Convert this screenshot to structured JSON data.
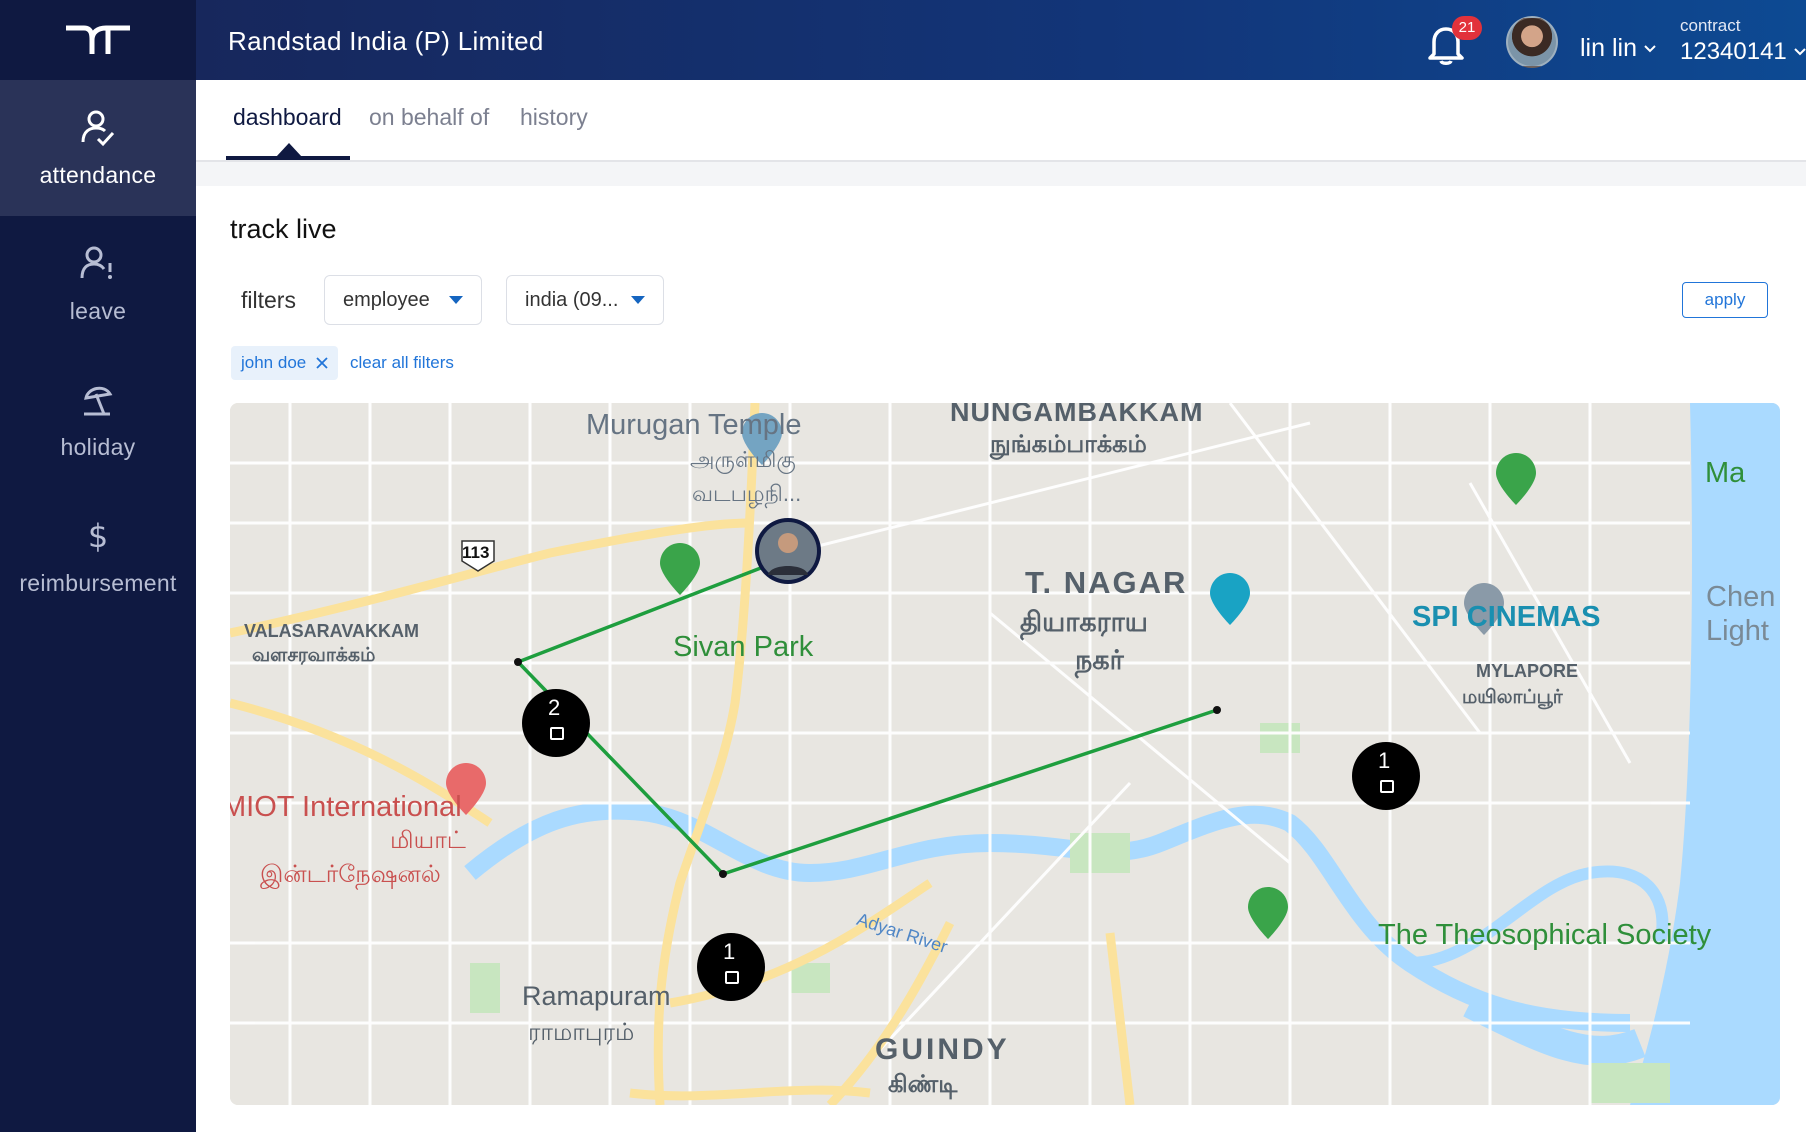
{
  "sidebar": {
    "items": [
      {
        "label": "attendance",
        "icon": "attendance-icon",
        "active": true
      },
      {
        "label": "leave",
        "icon": "leave-icon",
        "active": false
      },
      {
        "label": "holiday",
        "icon": "holiday-icon",
        "active": false
      },
      {
        "label": "reimbursement",
        "icon": "dollar-icon",
        "active": false
      }
    ]
  },
  "header": {
    "company": "Randstad India (P) Limited",
    "notification_count": "21",
    "user_name": "lin lin",
    "contract_label": "contract",
    "contract_number": "12340141"
  },
  "tabs": [
    {
      "label": "dashboard",
      "active": true
    },
    {
      "label": "on behalf of",
      "active": false
    },
    {
      "label": "history",
      "active": false
    }
  ],
  "main": {
    "title": "track live",
    "filters_label": "filters",
    "employee_select": "employee",
    "region_select": "india (09...",
    "apply_label": "apply",
    "active_chip": "john doe",
    "clear_label": "clear all filters"
  },
  "map": {
    "areas": {
      "nungambakkam": "NUNGAMBAKKAM",
      "nungambakkam_ta": "நுங்கம்பாக்கம்",
      "tnagar_1": "T. NAGAR",
      "tnagar_2": "தியாகராய",
      "tnagar_3": "நகர்",
      "valasaravakkam": "VALASARAVAKKAM",
      "valasaravakkam_ta": "வளசரவாக்கம்",
      "mylapore": "MYLAPORE",
      "mylapore_ta": "மயிலாப்பூர்",
      "ramapuram": "Ramapuram",
      "ramapuram_ta": "ராமாபுரம்",
      "guindy": "GUINDY",
      "guindy_ta": "கிண்டி"
    },
    "pois": {
      "murugan_1": "Murugan Temple",
      "murugan_2": "அருள்மிகு",
      "murugan_3": "வடபழநி...",
      "sivan_park": "Sivan Park",
      "spi": "SPI CINEMAS",
      "chen_1": "Chen",
      "chen_2": "Light",
      "ma": "Ma",
      "miot_1": "MIOT International",
      "miot_2": "மியாட்",
      "miot_3": "இன்டர்நேஷனல்",
      "theosophical": "The Theosophical Society",
      "adyar": "Adyar River",
      "highway": "113"
    },
    "markers": [
      {
        "num": "2",
        "type": "check-in"
      },
      {
        "num": "1",
        "type": "check-out"
      },
      {
        "num": "1",
        "type": "check-in"
      }
    ]
  },
  "colors": {
    "sidebar": "#0f1941",
    "route": "#1e9e3e",
    "accent": "#2175d9",
    "badge": "#e2323b"
  }
}
